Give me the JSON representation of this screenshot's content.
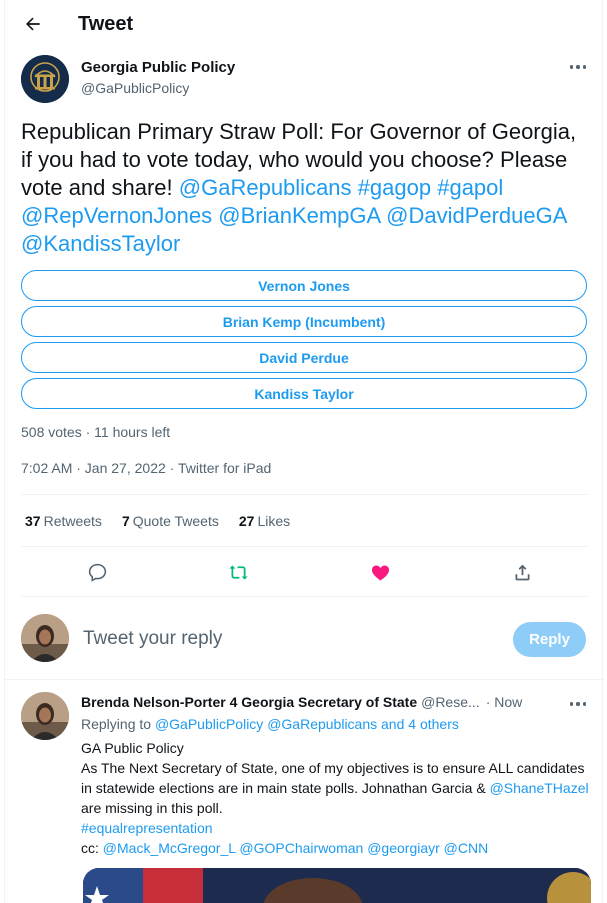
{
  "header": {
    "title": "Tweet"
  },
  "tweet": {
    "author_name": "Georgia Public Policy",
    "author_handle": "@GaPublicPolicy",
    "text_plain_1": "Republican Primary Straw Poll: For Governor of Georgia, if you had to vote today, who would you choose? Please vote and share! ",
    "mention_1": "@GaRepublicans",
    "hashtag_1": "#gagop",
    "hashtag_2": "#gapol",
    "mention_2": "@RepVernonJones",
    "mention_3": "@BrianKempGA",
    "mention_4": "@DavidPerdueGA",
    "mention_5": "@KandissTaylor",
    "poll_options": [
      "Vernon Jones",
      "Brian Kemp (Incumbent)",
      "David Perdue",
      "Kandiss Taylor"
    ],
    "poll_meta": "508 votes · 11 hours left",
    "timestamp": "7:02 AM · Jan 27, 2022 · Twitter for iPad",
    "stats": {
      "retweets_count": "37",
      "retweets_label": "Retweets",
      "quotes_count": "7",
      "quotes_label": "Quote Tweets",
      "likes_count": "27",
      "likes_label": "Likes"
    }
  },
  "icons": {
    "back": "arrow-left-icon",
    "reply": "comment-icon",
    "retweet": "retweet-icon",
    "like": "heart-icon",
    "share": "share-icon"
  },
  "colors": {
    "accent": "#1d9bf0",
    "retweet_active": "#00ba7c",
    "like_active": "#f91880",
    "reply_button_disabled": "#8ecdf8"
  },
  "composer": {
    "placeholder": "Tweet your reply",
    "button_label": "Reply"
  },
  "reply": {
    "author_name": "Brenda Nelson-Porter 4 Georgia Secretary of State",
    "author_handle": "@Rese...",
    "time": "· Now",
    "replying_prefix": "Replying to ",
    "replying_to": "@GaPublicPolicy @GaRepublicans and 4 others",
    "line_1": "GA Public Policy",
    "line_2": "As The Next Secretary of State, one of my objectives is to ensure ALL candidates in statewide elections are in main state polls. Johnathan Garcia & ",
    "line_2_mention": "@ShaneTHazel",
    "line_2_end": " are missing in this poll.",
    "hashtag": "#equalrepresentation",
    "cc_prefix": "cc: ",
    "cc_mentions": "@Mack_McGregor_L @GOPChairwoman @georgiayr @CNN"
  }
}
